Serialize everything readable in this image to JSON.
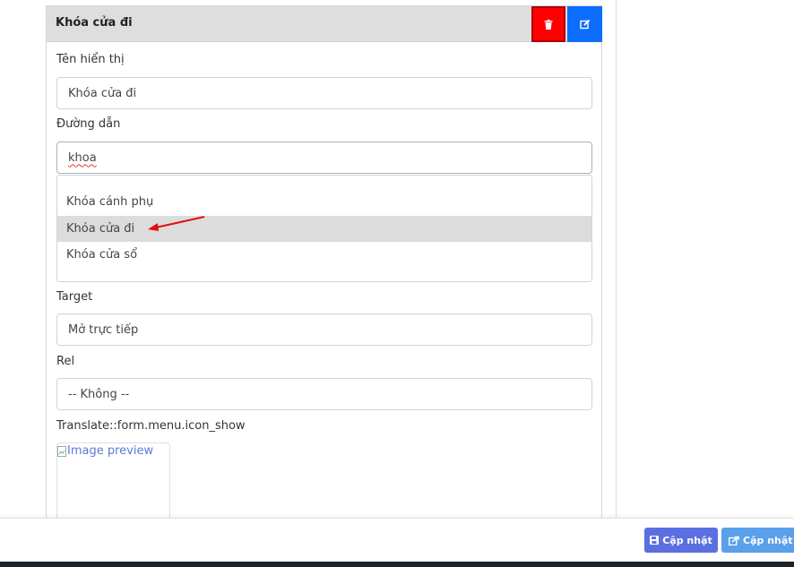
{
  "panel": {
    "title": "Khóa cửa đi",
    "delete_icon": "trash-icon",
    "edit_icon": "edit-icon",
    "colors": {
      "delete": "#ff0000",
      "edit": "#0d6efd"
    }
  },
  "form": {
    "display_name": {
      "label": "Tên hiển thị",
      "value": "Khóa cửa đi"
    },
    "path": {
      "label": "Đường dẫn",
      "value": "khoa"
    },
    "suggestions": [
      {
        "label": "Khóa cánh phụ",
        "selected": false
      },
      {
        "label": "Khóa cửa đi",
        "selected": true
      },
      {
        "label": "Khóa cửa sổ",
        "selected": false
      }
    ],
    "target": {
      "label": "Target",
      "value": "Mở trực tiếp"
    },
    "rel": {
      "label": "Rel",
      "value": "-- Không --"
    },
    "icon_show": {
      "label": "Translate::form.menu.icon_show",
      "image_alt": "Image preview"
    }
  },
  "footer": {
    "update_label": "Cập nhật",
    "update_icon": "save-icon",
    "update_and_label": "Cập nhật v",
    "update_and_icon": "share-icon"
  }
}
